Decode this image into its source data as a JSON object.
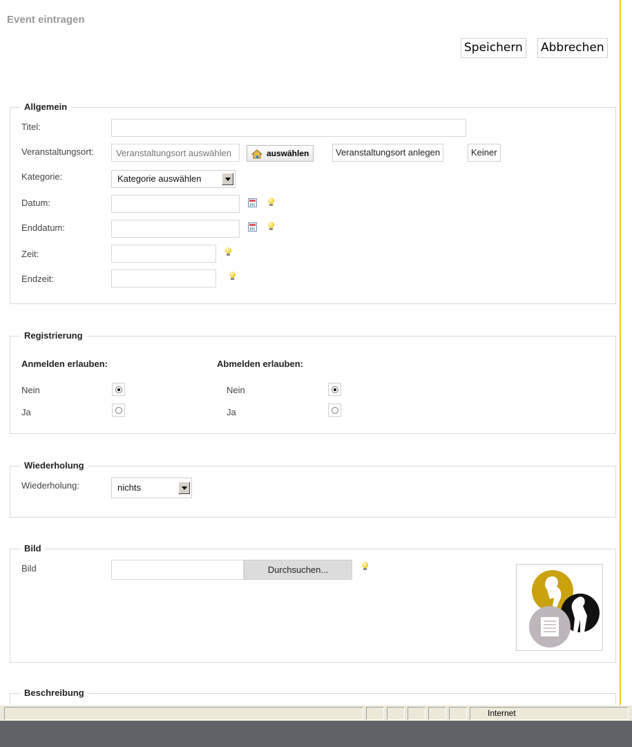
{
  "page": {
    "title": "Event eintragen"
  },
  "toolbar": {
    "save_label": "Speichern",
    "cancel_label": "Abbrechen"
  },
  "general": {
    "legend": "Allgemein",
    "title_label": "Titel:",
    "venue_label": "Veranstaltungsort:",
    "venue_placeholder": "Veranstaltungsort auswählen",
    "venue_select_label": "auswählen",
    "venue_create_label": "Veranstaltungsort anlegen",
    "venue_none_label": "Keiner",
    "category_label": "Kategorie:",
    "category_value": "Kategorie auswählen",
    "date_label": "Datum:",
    "enddate_label": "Enddatum:",
    "time_label": "Zeit:",
    "endtime_label": "Endzeit:"
  },
  "registration": {
    "legend": "Registrierung",
    "signup_heading": "Anmelden erlauben:",
    "signoff_heading": "Abmelden erlauben:",
    "no_label": "Nein",
    "yes_label": "Ja",
    "signup_selected": "Nein",
    "signoff_selected": "Nein"
  },
  "repeat": {
    "legend": "Wiederholung",
    "label": "Wiederholung:",
    "value": "nichts"
  },
  "image": {
    "legend": "Bild",
    "label": "Bild",
    "browse_label": "Durchsuchen..."
  },
  "description": {
    "legend": "Beschreibung"
  },
  "statusbar": {
    "zone": "Internet"
  },
  "colors": {
    "accent_line": "#f0c419",
    "taskbar": "#5f6368",
    "statusbar": "#ece9d8"
  }
}
